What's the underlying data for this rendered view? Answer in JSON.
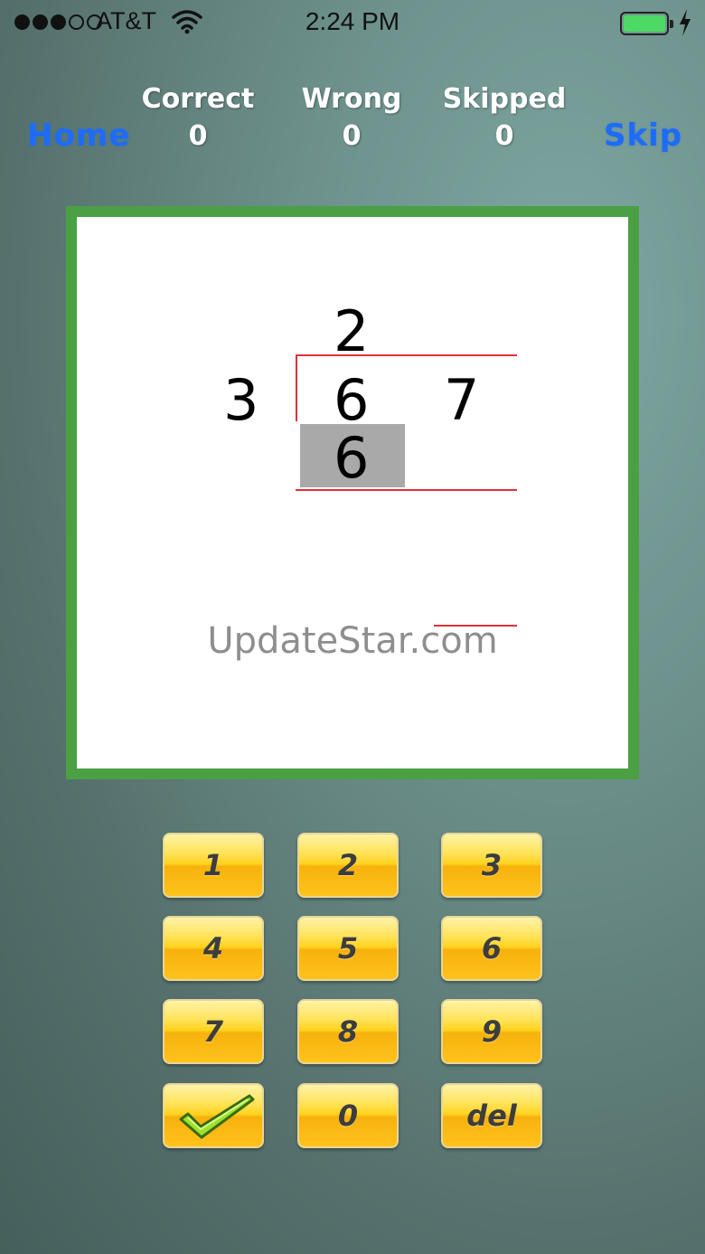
{
  "status_bar": {
    "carrier": "AT&T",
    "time": "2:24 PM",
    "signal_bars_filled": 3,
    "signal_bars_total": 5,
    "battery_color": "#4cd964"
  },
  "top_bar": {
    "home_label": "Home",
    "skip_label": "Skip",
    "stats": [
      {
        "label": "Correct",
        "value": "0"
      },
      {
        "label": "Wrong",
        "value": "0"
      },
      {
        "label": "Skipped",
        "value": "0"
      }
    ]
  },
  "problem": {
    "divisor": "3",
    "dividend_digits": [
      "6",
      "7"
    ],
    "quotient_digit": "2",
    "work_digit": "6",
    "board_color": "#4aa043",
    "guide_line_color": "#e0303a"
  },
  "watermark": "UpdateStar.com",
  "keypad": {
    "keys": [
      "1",
      "2",
      "3",
      "4",
      "5",
      "6",
      "7",
      "8",
      "9",
      "check-icon",
      "0",
      "del"
    ]
  }
}
